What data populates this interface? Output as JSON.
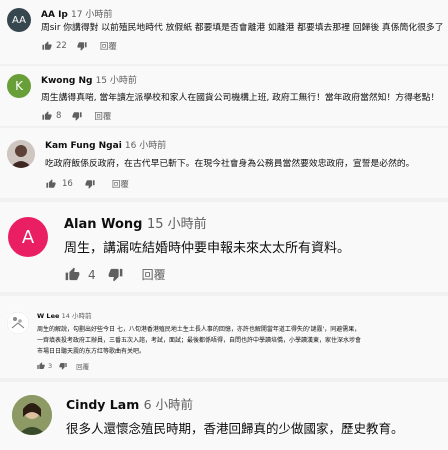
{
  "comments": [
    {
      "initials": "AA",
      "avatar_color": "#37474f",
      "author": "AA Ip",
      "time": "17 小時前",
      "lines": [
        "周sir 你講得對 以前殖民地時代 放假紙 都要填是否會離港 如離港 都要填去那裡 回歸後 真係簡化很多了"
      ],
      "likes": "22",
      "reply_label": "回覆"
    },
    {
      "initials": "K",
      "avatar_color": "#689f38",
      "author": "Kwong Ng",
      "time": "15 小時前",
      "lines": [
        "周生講得真啱, 當年讀左派學校和家人在國貨公司機構上班, 政府工無行！當年政府當然知！方得老點！"
      ],
      "likes": "8",
      "reply_label": "回覆"
    },
    {
      "initials": "",
      "avatar_color": "#5d4037",
      "author": "Kam Fung Ngai",
      "time": "16 小時前",
      "lines": [
        "吃政府飯係反政府，在古代早已斬下。在現今社會身為公務員當然要效忠政府，宣誓是必然的。"
      ],
      "likes": "16",
      "reply_label": "回覆"
    },
    {
      "initials": "A",
      "avatar_color": "#e91e63",
      "author": "Alan Wong",
      "time": "15 小時前",
      "lines": [
        "周生，講漏咗結婚時仲要申報未來太太所有資料。"
      ],
      "likes": "4",
      "reply_label": "回覆"
    },
    {
      "initials": "",
      "avatar_color": "#ffffff",
      "author": "W Lee",
      "time": "14 小時前",
      "lines": [
        "周生的解說，勾劃出好些今日 七，八旬港香港殖民地土生土長人事的回憶，亦許也解開當年道工得失的'謎霧'，同避需果，",
        "一齊填表投考政府工辦員，三番五次入諮，考試，面試；最後都係唔得，自問也許中學讀培僑，小學讀漢東，家住深水埗會",
        "市場日日聽天震的东方红等歌曲有关吧。"
      ],
      "likes": "3",
      "reply_label": "回覆"
    },
    {
      "initials": "",
      "avatar_color": "#7a8a55",
      "author": "Cindy Lam",
      "time": "6 小時前",
      "lines": [
        "很多人還懷念殖民時期，香港回歸真的少做國家，歷史教育。"
      ],
      "likes": "",
      "reply_label": ""
    }
  ]
}
